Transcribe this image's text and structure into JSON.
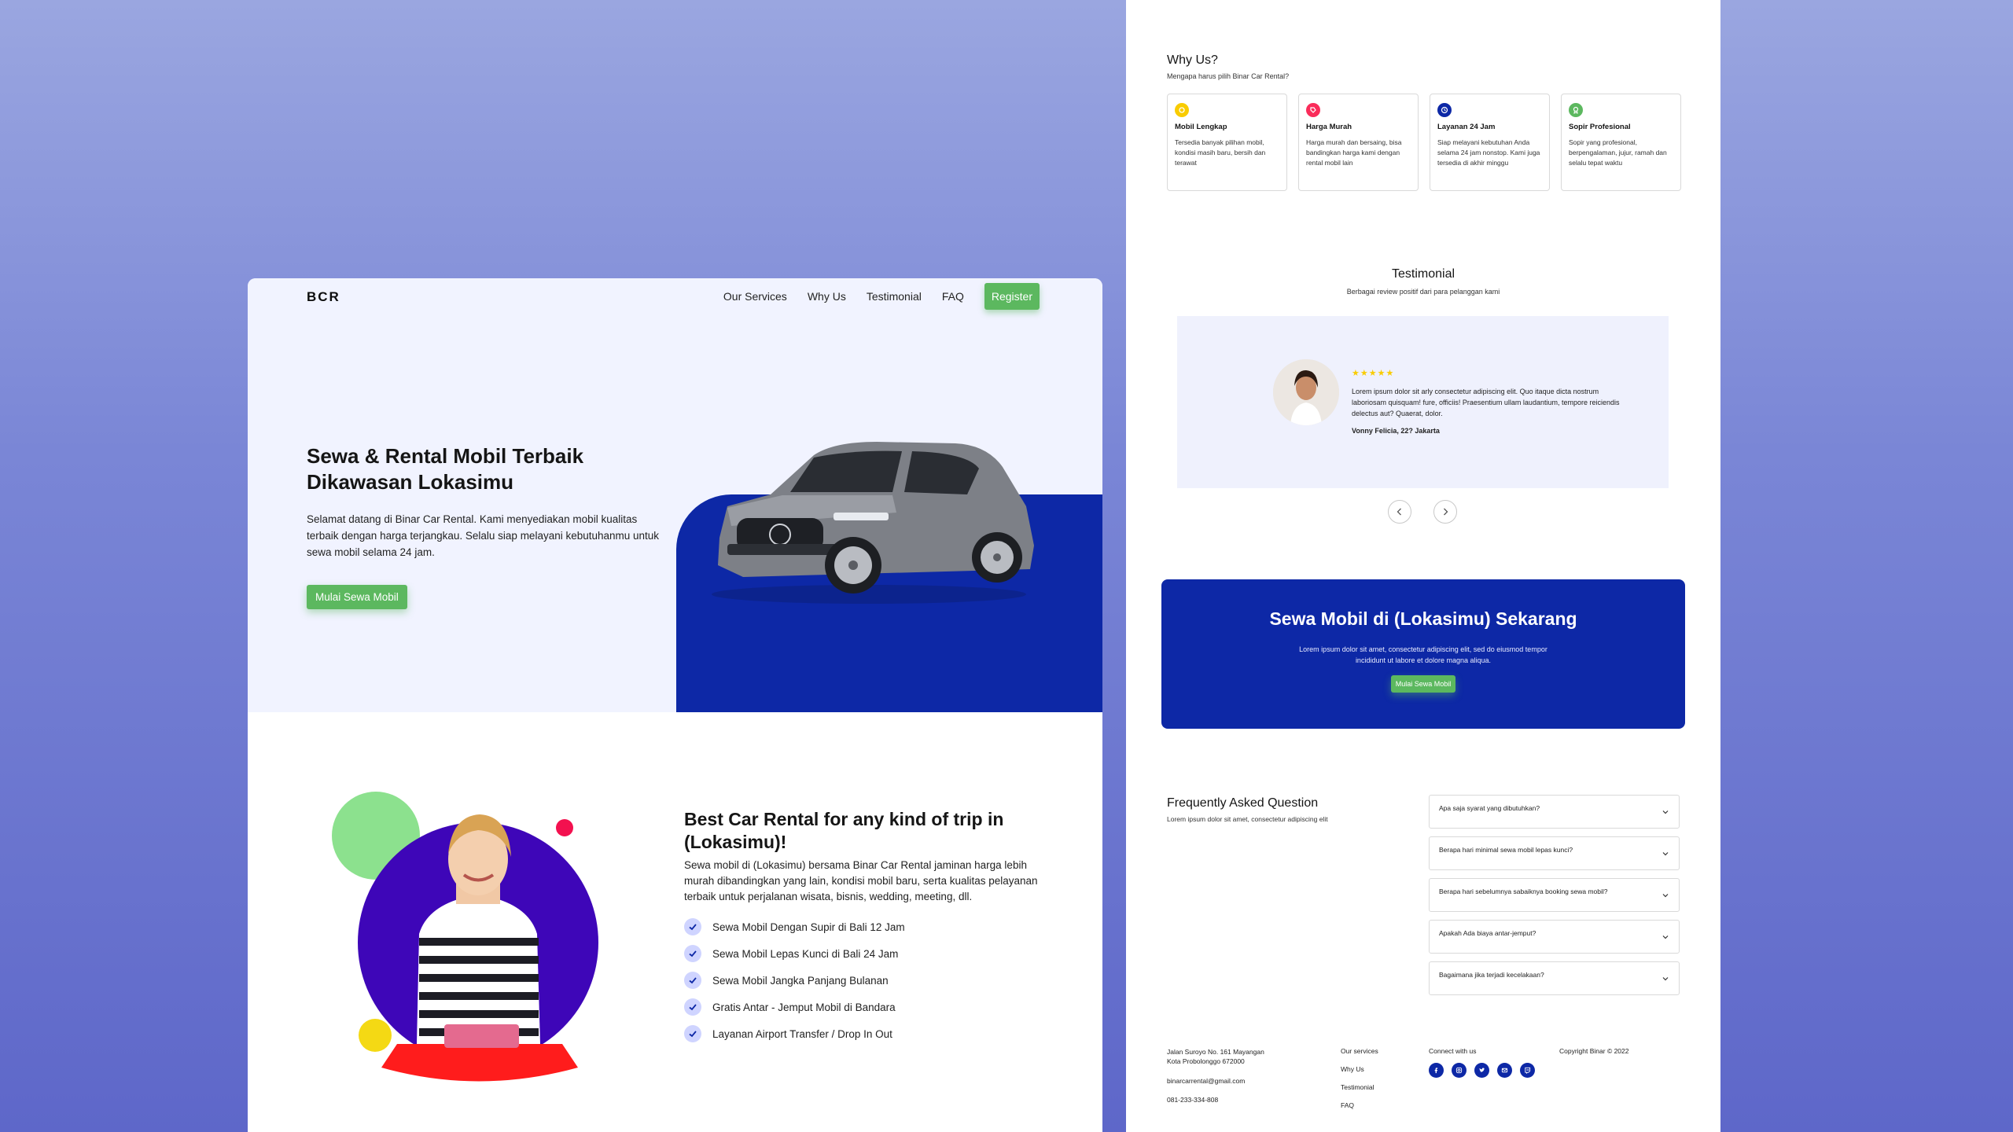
{
  "brand": "BCR",
  "nav": {
    "items": [
      "Our Services",
      "Why Us",
      "Testimonial",
      "FAQ"
    ],
    "register": "Register"
  },
  "hero": {
    "title": "Sewa & Rental Mobil Terbaik Dikawasan Lokasimu",
    "description": "Selamat datang di Binar Car Rental. Kami menyediakan mobil kualitas terbaik dengan harga terjangkau. Selalu siap melayani kebutuhanmu untuk sewa mobil selama 24 jam.",
    "cta": "Mulai Sewa Mobil"
  },
  "about": {
    "title": "Best Car Rental for any kind of trip in (Lokasimu)!",
    "description": "Sewa mobil di (Lokasimu) bersama Binar Car Rental jaminan harga lebih murah dibandingkan yang lain, kondisi mobil baru, serta kualitas pelayanan terbaik untuk perjalanan wisata, bisnis, wedding, meeting, dll.",
    "items": [
      "Sewa Mobil Dengan Supir di Bali 12 Jam",
      "Sewa Mobil Lepas Kunci di Bali 24 Jam",
      "Sewa Mobil Jangka Panjang Bulanan",
      "Gratis Antar - Jemput Mobil di Bandara",
      "Layanan Airport Transfer / Drop In Out"
    ]
  },
  "why": {
    "title": "Why Us?",
    "subtitle": "Mengapa harus pilih Binar Car Rental?",
    "cards": [
      {
        "title": "Mobil Lengkap",
        "desc": "Tersedia banyak pilihan mobil, kondisi masih baru, bersih dan terawat",
        "color": "#f9cc00",
        "icon": "thumbs-up-icon"
      },
      {
        "title": "Harga Murah",
        "desc": "Harga murah dan bersaing, bisa bandingkan harga kami dengan rental mobil lain",
        "color": "#fa2c5a",
        "icon": "price-tag-icon"
      },
      {
        "title": "Layanan 24 Jam",
        "desc": "Siap melayani kebutuhan Anda selama 24 jam nonstop. Kami juga tersedia di akhir minggu",
        "color": "#0d28a6",
        "icon": "clock-icon"
      },
      {
        "title": "Sopir Profesional",
        "desc": "Sopir yang profesional, berpengalaman, jujur, ramah dan selalu tepat waktu",
        "color": "#5cb85f",
        "icon": "award-icon"
      }
    ]
  },
  "testimonial": {
    "title": "Testimonial",
    "subtitle": "Berbagai review positif dari para pelanggan kami",
    "rating": 5,
    "stars": "★★★★★",
    "text": "Lorem ipsum dolor sit arly consectetur adipiscing elit. Quo itaque dicta nostrum laboriosam quisquam! fure, officiis! Praesentium ullam laudantium, tempore reiciendis delectus aut? Quaerat, dolor.",
    "name": "Vonny Felicia, 22? Jakarta"
  },
  "cta": {
    "title": "Sewa Mobil di (Lokasimu) Sekarang",
    "description": "Lorem ipsum dolor sit amet, consectetur adipiscing elit, sed do eiusmod tempor incididunt ut labore et dolore magna aliqua.",
    "button": "Mulai Sewa Mobil"
  },
  "faq": {
    "title": "Frequently Asked Question",
    "subtitle": "Lorem ipsum dolor sit amet, consectetur adipiscing elit",
    "items": [
      "Apa saja syarat yang dibutuhkan?",
      "Berapa hari minimal sewa mobil lepas kunci?",
      "Berapa hari sebelumnya sabaiknya booking sewa mobil?",
      "Apakah Ada biaya antar-jemput?",
      "Bagaimana jika terjadi kecelakaan?"
    ]
  },
  "footer": {
    "address": "Jalan Suroyo No. 161 Mayangan Kota Probolonggo 672000",
    "email": "binarcarrental@gmail.com",
    "phone": "081-233-334-808",
    "links": [
      "Our services",
      "Why Us",
      "Testimonial",
      "FAQ"
    ],
    "connect": "Connect with us",
    "copyright": "Copyright Binar © 2022"
  },
  "colors": {
    "primary": "#0d28a6",
    "accent_green": "#5cb85f",
    "hero_bg": "#f1f3ff"
  }
}
